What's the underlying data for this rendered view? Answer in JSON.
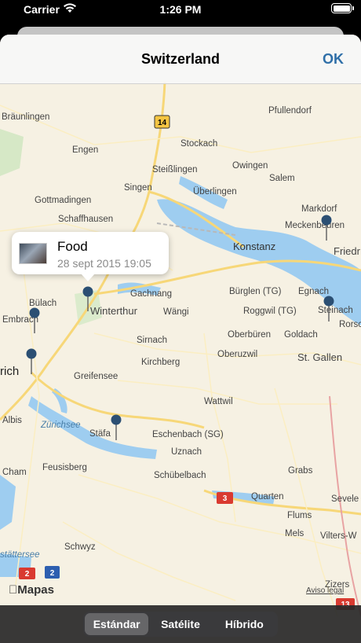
{
  "status": {
    "carrier": "Carrier",
    "time": "1:26 PM"
  },
  "navbar": {
    "title": "Switzerland",
    "ok_label": "OK"
  },
  "callout": {
    "title": "Food",
    "subtitle": "28 sept 2015 19:05"
  },
  "map": {
    "places": [
      "Bräunlingen",
      "Pfullendorf",
      "Stockach",
      "Engen",
      "Singen",
      "Steißlingen",
      "Owingen",
      "Salem",
      "Gottmadingen",
      "Überlingen",
      "Schaffhausen",
      "Markdorf",
      "Meckenbeuren",
      "Friedr",
      "Konstanz",
      "Gachnang",
      "Winterthur",
      "Bülach",
      "Embrach",
      "Wängi",
      "Egnach",
      "Bürglen (TG)",
      "Roggwil (TG)",
      "Steinach",
      "Rorsc",
      "Sirnach",
      "Oberbüren",
      "Goldach",
      "Kirchberg",
      "Oberuzwil",
      "St. Gallen",
      "Greifensee",
      "rich",
      "Wattwil",
      "Albis",
      "Zürichsee",
      "Stäfa",
      "Eschenbach (SG)",
      "Uznach",
      "Feusisberg",
      "Schübelbach",
      "Cham",
      "Quarten",
      "Grabs",
      "Sevele",
      "Flums",
      "Mels",
      "Vilters-W",
      "Schwyz",
      "stättersee",
      "Zizers"
    ],
    "roads": [
      "14",
      "3",
      "2",
      "2",
      "13"
    ],
    "logo": "Mapas",
    "legal": "Aviso legal"
  },
  "toolbar": {
    "segments": [
      "Estándar",
      "Satélite",
      "Híbrido"
    ],
    "selected": "Estándar"
  },
  "colors": {
    "accent": "#2f6fa8",
    "water": "#9ecdf0",
    "land": "#f6f1e3",
    "pin": "#2b4f73"
  }
}
